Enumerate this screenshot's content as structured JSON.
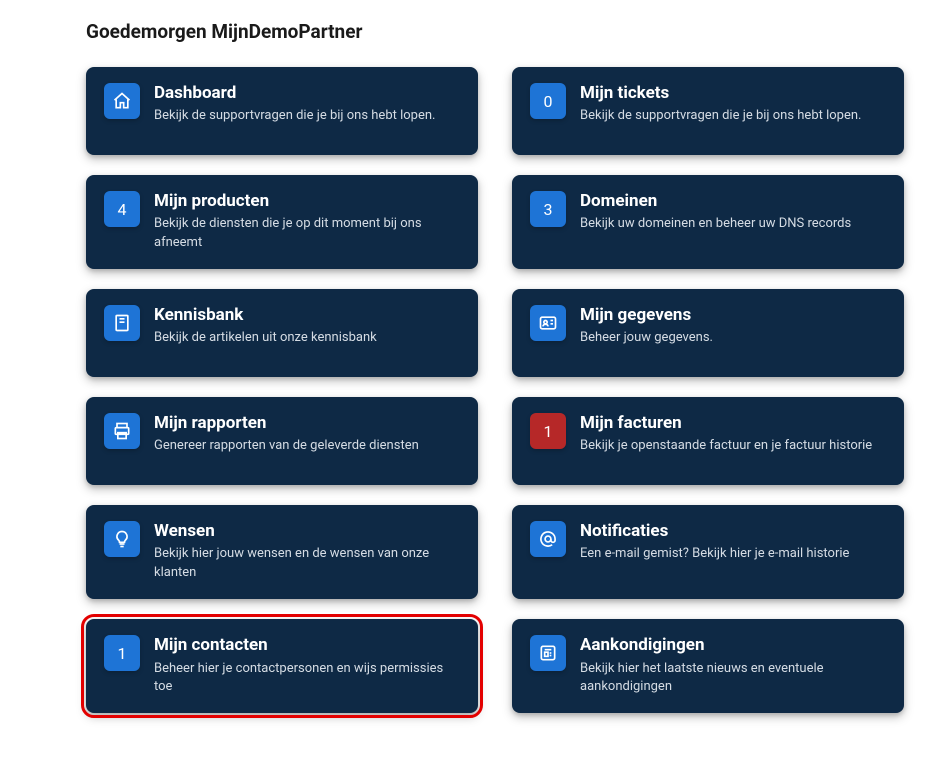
{
  "header": {
    "title": "Goedemorgen MijnDemoPartner"
  },
  "cards": [
    {
      "id": "dashboard",
      "icon": "house-icon",
      "iconType": "svg",
      "title": "Dashboard",
      "desc": "Bekijk de supportvragen die je bij ons hebt lopen."
    },
    {
      "id": "tickets",
      "icon": "count",
      "iconValue": "0",
      "title": "Mijn tickets",
      "desc": "Bekijk de supportvragen die je bij ons hebt lopen."
    },
    {
      "id": "products",
      "icon": "count",
      "iconValue": "4",
      "title": "Mijn producten",
      "desc": "Bekijk de diensten die je op dit moment bij ons afneemt"
    },
    {
      "id": "domains",
      "icon": "count",
      "iconValue": "3",
      "title": "Domeinen",
      "desc": "Bekijk uw domeinen en beheer uw DNS records"
    },
    {
      "id": "knowledge",
      "icon": "book-icon",
      "iconType": "svg",
      "title": "Kennisbank",
      "desc": "Bekijk de artikelen uit onze kennisbank"
    },
    {
      "id": "profile",
      "icon": "id-card-icon",
      "iconType": "svg",
      "title": "Mijn gegevens",
      "desc": "Beheer jouw gegevens."
    },
    {
      "id": "reports",
      "icon": "printer-icon",
      "iconType": "svg",
      "title": "Mijn rapporten",
      "desc": "Genereer rapporten van de geleverde diensten"
    },
    {
      "id": "invoices",
      "icon": "count",
      "iconValue": "1",
      "iconColor": "red",
      "title": "Mijn facturen",
      "desc": "Bekijk je openstaande factuur en je factuur historie"
    },
    {
      "id": "wishes",
      "icon": "bulb-icon",
      "iconType": "svg",
      "title": "Wensen",
      "desc": "Bekijk hier jouw wensen en de wensen van onze klanten"
    },
    {
      "id": "notifications",
      "icon": "at-icon",
      "iconType": "svg",
      "title": "Notificaties",
      "desc": "Een e-mail gemist? Bekijk hier je e-mail historie"
    },
    {
      "id": "contacts",
      "icon": "count",
      "iconValue": "1",
      "highlight": true,
      "title": "Mijn contacten",
      "desc": "Beheer hier je contactpersonen en wijs permissies toe"
    },
    {
      "id": "announcements",
      "icon": "newspaper-icon",
      "iconType": "svg",
      "title": "Aankondigingen",
      "desc": "Bekijk hier het laatste nieuws en eventuele aankondigingen"
    }
  ]
}
